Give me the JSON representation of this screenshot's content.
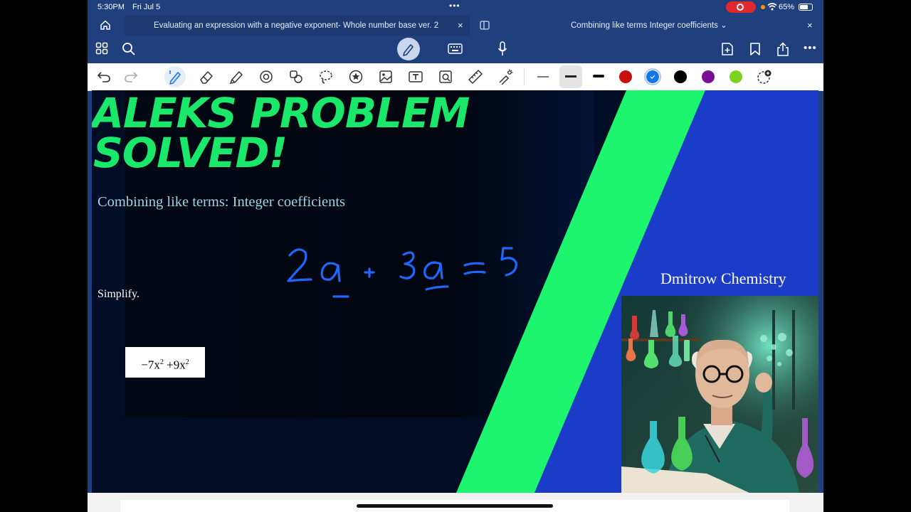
{
  "status_bar": {
    "time": "5:30PM",
    "date": "Fri Jul 5",
    "battery": "65%",
    "multitask": "•••"
  },
  "tabs": [
    {
      "title": "Evaluating an expression with a negative exponent- Whole number base ver. 2",
      "close": "×"
    },
    {
      "title": "Combining like terms Integer coefficients ⌄",
      "close": "×"
    }
  ],
  "toolbar": {
    "left_icons": [
      "grid-icon",
      "search-icon"
    ],
    "center_icons": [
      "pen-mode-icon",
      "keyboard-icon",
      "microphone-icon"
    ],
    "right_icons": [
      "add-page-icon",
      "bookmark-icon",
      "share-icon",
      "more-icon"
    ],
    "more": "•••"
  },
  "drawing_tools": {
    "icons": [
      "undo-icon",
      "redo-icon",
      "pen-icon",
      "eraser-icon",
      "highlighter-icon",
      "shapes-icon",
      "elements-icon",
      "lasso-icon",
      "sticker-icon",
      "image-icon",
      "text-icon",
      "camera-icon",
      "ruler-icon",
      "laser-icon"
    ],
    "thickness": [
      "thin",
      "medium",
      "thick"
    ],
    "colors": [
      "#c80f0f",
      "#1877e8",
      "#000000",
      "#7a0f96",
      "#7ed321"
    ]
  },
  "slide": {
    "title_line1": "ALEKS PROBLEM",
    "title_line2": "SOLVED!",
    "subtitle": "Combining like terms: Integer coefficients",
    "simplify": "Simplify.",
    "expression": {
      "t1": "−7x",
      "e1": "2",
      "op": " +9x",
      "e2": "2"
    },
    "handwriting": "2a + 3a = 5",
    "author": "Dmitrow Chemistry",
    "accent": "#1ef56e",
    "ink": "#1f66ff"
  }
}
